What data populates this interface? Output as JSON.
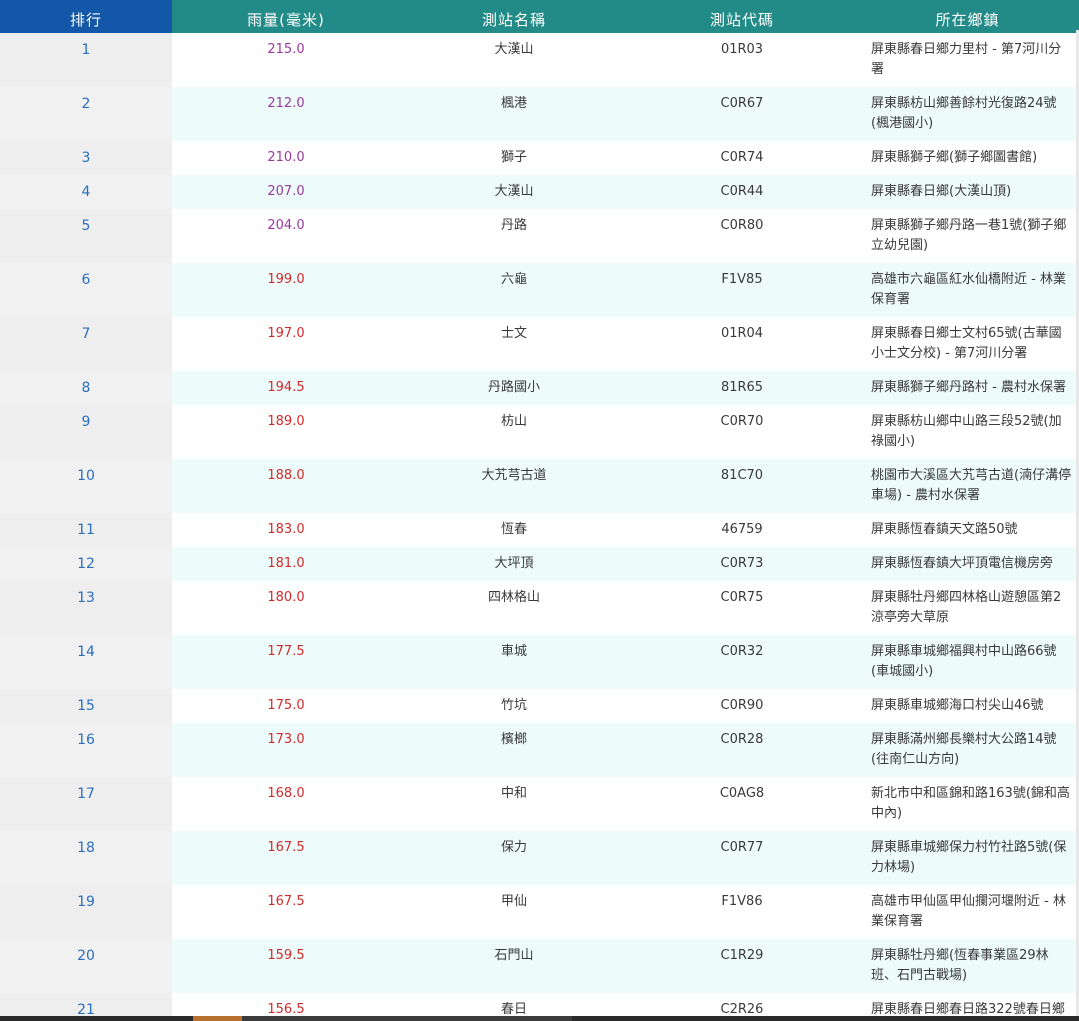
{
  "table": {
    "headers": {
      "rank": "排行",
      "rainfall": "雨量(毫米)",
      "station_name": "測站名稱",
      "station_code": "測站代碼",
      "township": "所在鄉鎮"
    },
    "colors": {
      "header_rank_bg": "#1257a8",
      "header_bg": "#228b88",
      "rank_text": "#2b6fbd",
      "rain_purple": "#9b3a9e",
      "rain_red": "#d42a2a",
      "alt_row_bg": "#eefbfb"
    },
    "rows": [
      {
        "rank": "1",
        "rainfall": "215.0",
        "color": "purple",
        "station": "大漢山",
        "code": "01R03",
        "town": "屏東縣春日鄉力里村 - 第7河川分署"
      },
      {
        "rank": "2",
        "rainfall": "212.0",
        "color": "purple",
        "station": "楓港",
        "code": "C0R67",
        "town": "屏東縣枋山鄉善餘村光復路24號(楓港國小)"
      },
      {
        "rank": "3",
        "rainfall": "210.0",
        "color": "purple",
        "station": "獅子",
        "code": "C0R74",
        "town": "屏東縣獅子鄉(獅子鄉圖書館)"
      },
      {
        "rank": "4",
        "rainfall": "207.0",
        "color": "purple",
        "station": "大漢山",
        "code": "C0R44",
        "town": "屏東縣春日鄉(大漢山頂)"
      },
      {
        "rank": "5",
        "rainfall": "204.0",
        "color": "purple",
        "station": "丹路",
        "code": "C0R80",
        "town": "屏東縣獅子鄉丹路一巷1號(獅子鄉立幼兒園)"
      },
      {
        "rank": "6",
        "rainfall": "199.0",
        "color": "red",
        "station": "六龜",
        "code": "F1V85",
        "town": "高雄市六龜區紅水仙橋附近 - 林業保育署"
      },
      {
        "rank": "7",
        "rainfall": "197.0",
        "color": "red",
        "station": "士文",
        "code": "01R04",
        "town": "屏東縣春日鄉士文村65號(古華國小士文分校) - 第7河川分署"
      },
      {
        "rank": "8",
        "rainfall": "194.5",
        "color": "red",
        "station": "丹路國小",
        "code": "81R65",
        "town": "屏東縣獅子鄉丹路村 - 農村水保署"
      },
      {
        "rank": "9",
        "rainfall": "189.0",
        "color": "red",
        "station": "枋山",
        "code": "C0R70",
        "town": "屏東縣枋山鄉中山路三段52號(加祿國小)"
      },
      {
        "rank": "10",
        "rainfall": "188.0",
        "color": "red",
        "station": "大艽芎古道",
        "code": "81C70",
        "town": "桃園市大溪區大艽芎古道(湳仔溝停車場) - 農村水保署"
      },
      {
        "rank": "11",
        "rainfall": "183.0",
        "color": "red",
        "station": "恆春",
        "code": "46759",
        "town": "屏東縣恆春鎮天文路50號"
      },
      {
        "rank": "12",
        "rainfall": "181.0",
        "color": "red",
        "station": "大坪頂",
        "code": "C0R73",
        "town": "屏東縣恆春鎮大坪頂電信機房旁"
      },
      {
        "rank": "13",
        "rainfall": "180.0",
        "color": "red",
        "station": "四林格山",
        "code": "C0R75",
        "town": "屏東縣牡丹鄉四林格山遊憩區第2涼亭旁大草原"
      },
      {
        "rank": "14",
        "rainfall": "177.5",
        "color": "red",
        "station": "車城",
        "code": "C0R32",
        "town": "屏東縣車城鄉福興村中山路66號(車城國小)"
      },
      {
        "rank": "15",
        "rainfall": "175.0",
        "color": "red",
        "station": "竹坑",
        "code": "C0R90",
        "town": "屏東縣車城鄉海口村尖山46號"
      },
      {
        "rank": "16",
        "rainfall": "173.0",
        "color": "red",
        "station": "檳榔",
        "code": "C0R28",
        "town": "屏東縣滿州鄉長樂村大公路14號(往南仁山方向)"
      },
      {
        "rank": "17",
        "rainfall": "168.0",
        "color": "red",
        "station": "中和",
        "code": "C0AG8",
        "town": "新北市中和區錦和路163號(錦和高中內)"
      },
      {
        "rank": "18",
        "rainfall": "167.5",
        "color": "red",
        "station": "保力",
        "code": "C0R77",
        "town": "屏東縣車城鄉保力村竹社路5號(保力林場)"
      },
      {
        "rank": "19",
        "rainfall": "167.5",
        "color": "red",
        "station": "甲仙",
        "code": "F1V86",
        "town": "高雄市甲仙區甲仙攔河堰附近 - 林業保育署"
      },
      {
        "rank": "20",
        "rainfall": "159.5",
        "color": "red",
        "station": "石門山",
        "code": "C1R29",
        "town": "屏東縣牡丹鄉(恆春事業區29林班、石門古戰場)"
      },
      {
        "rank": "21",
        "rainfall": "156.5",
        "color": "red",
        "station": "春日",
        "code": "C2R26",
        "town": "屏東縣春日鄉春日路322號春日鄉"
      }
    ]
  }
}
